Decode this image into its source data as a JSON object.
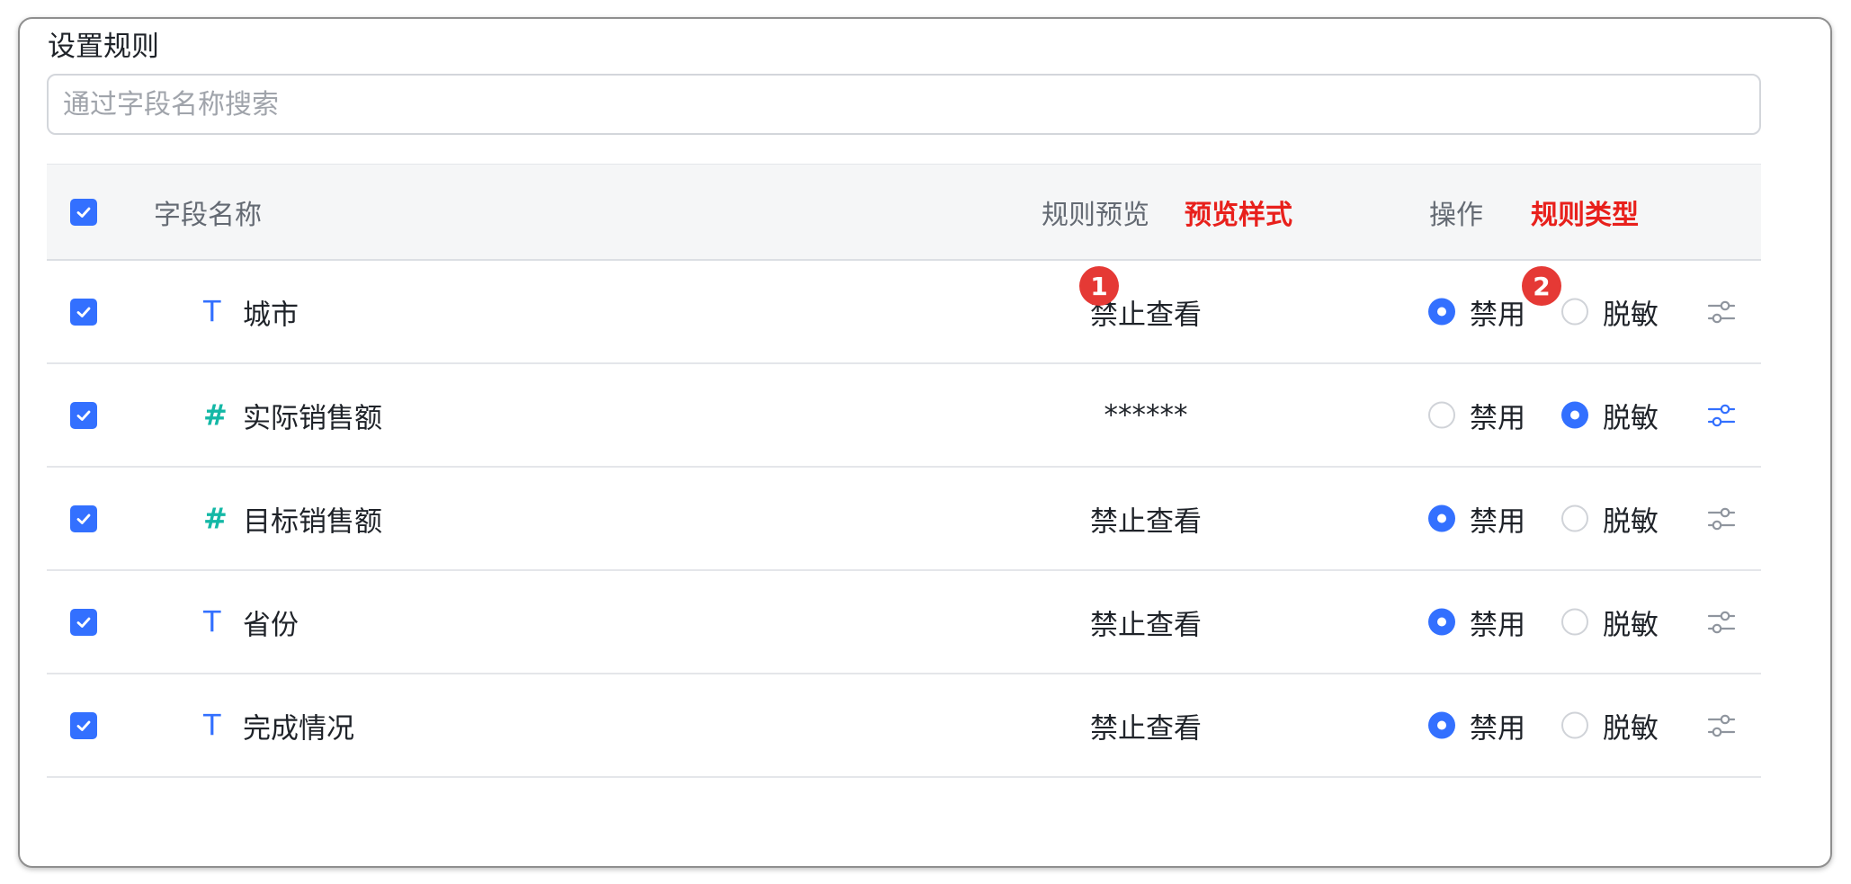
{
  "title": "设置规则",
  "search": {
    "placeholder": "通过字段名称搜索",
    "value": ""
  },
  "table": {
    "headers": {
      "field_name": "字段名称",
      "rule_preview": "规则预览",
      "operation": "操作"
    },
    "annotations": {
      "preview_style": "预览样式",
      "rule_type": "规则类型",
      "badge_1": "1",
      "badge_2": "2"
    },
    "option_labels": {
      "disable": "禁用",
      "mask": "脱敏"
    },
    "rows": [
      {
        "type_icon": "T",
        "type": "text",
        "name": "城市",
        "preview": "禁止查看",
        "rule": "disable",
        "checked": true
      },
      {
        "type_icon": "#",
        "type": "number",
        "name": "实际销售额",
        "preview": "******",
        "rule": "mask",
        "checked": true
      },
      {
        "type_icon": "#",
        "type": "number",
        "name": "目标销售额",
        "preview": "禁止查看",
        "rule": "disable",
        "checked": true
      },
      {
        "type_icon": "T",
        "type": "text",
        "name": "省份",
        "preview": "禁止查看",
        "rule": "disable",
        "checked": true
      },
      {
        "type_icon": "T",
        "type": "text",
        "name": "完成情况",
        "preview": "禁止查看",
        "rule": "disable",
        "checked": true
      }
    ]
  },
  "colors": {
    "accent": "#3370ff",
    "annotation_red": "#e8201c",
    "number_icon": "#14b8a6",
    "icon_gray": "#8f959e"
  }
}
